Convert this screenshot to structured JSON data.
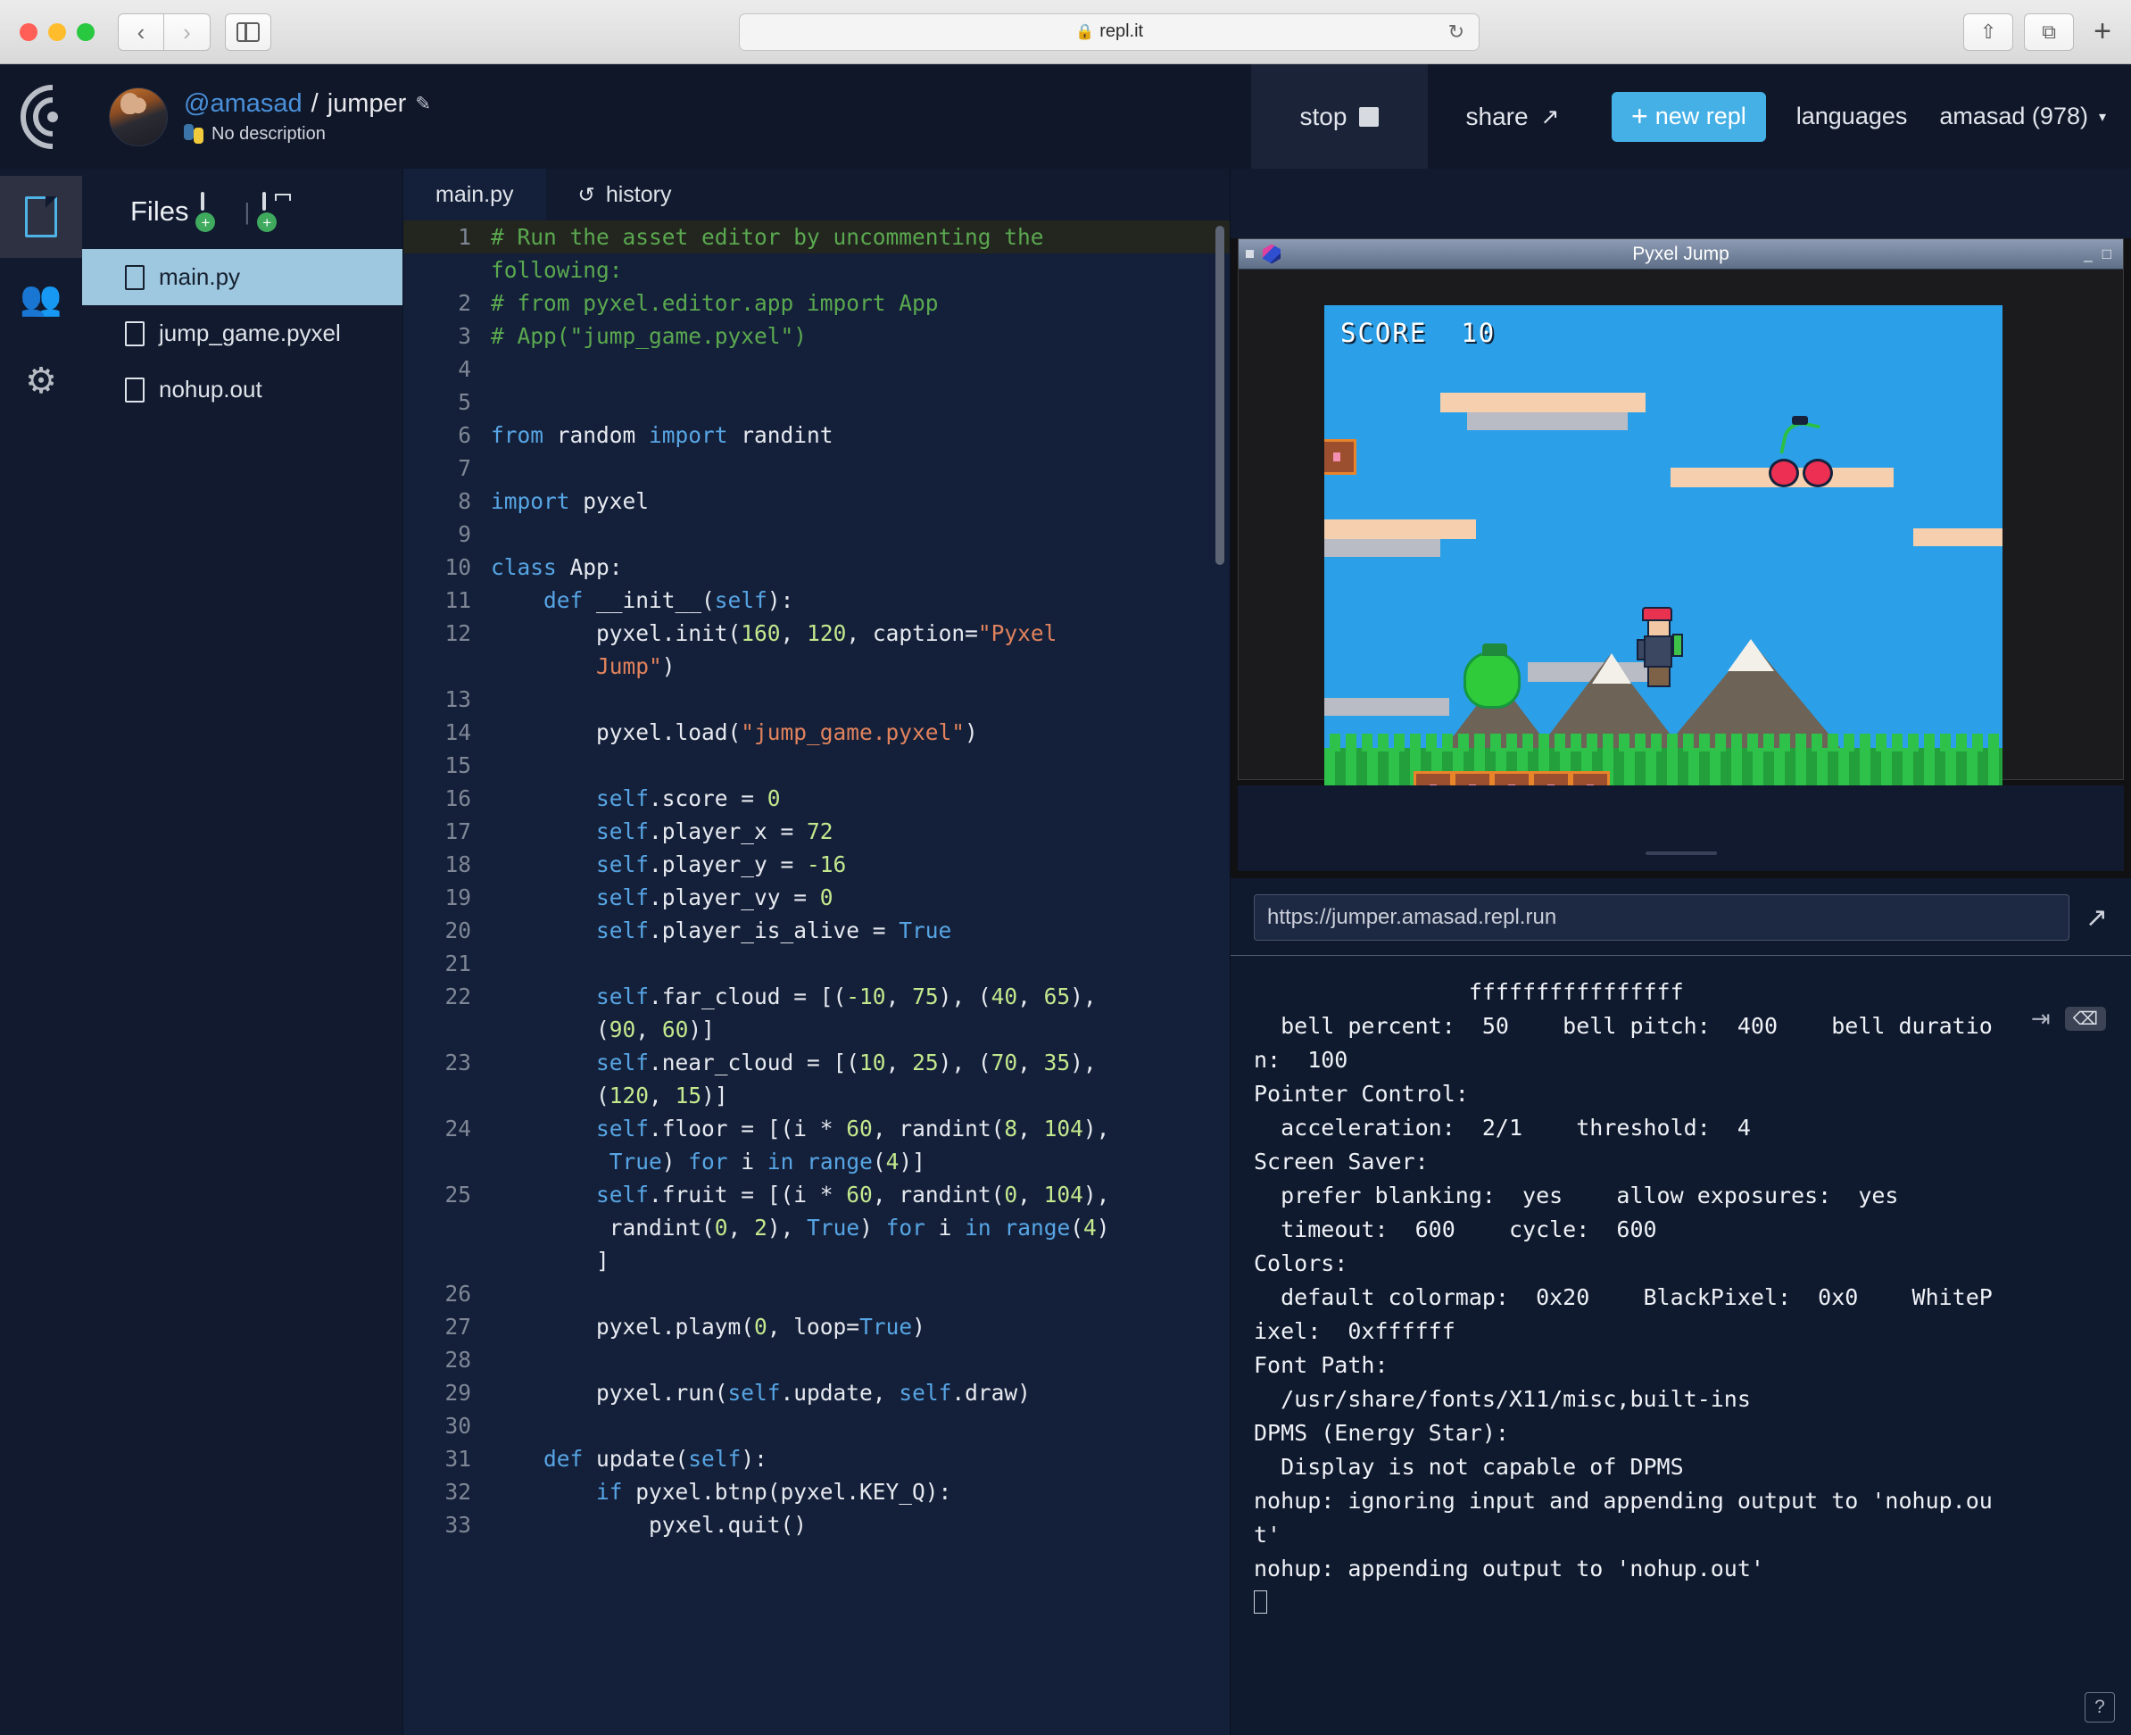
{
  "browser": {
    "url": "repl.it",
    "lock_icon": "lock-icon",
    "reload_icon": "reload-icon",
    "back_icon": "chevron-left-icon",
    "forward_icon": "chevron-right-icon",
    "sidebar_icon": "sidebar-toggle-icon",
    "share_icon": "share-icon",
    "tabs_icon": "tabs-overview-icon",
    "newtab_icon": "plus-icon"
  },
  "header": {
    "logo_icon": "replit-logo-icon",
    "avatar": "user-avatar",
    "username": "@amasad",
    "slash": "/",
    "replname": "jumper",
    "edit_icon": "pencil-icon",
    "language_icon": "python-icon",
    "description": "No description",
    "stop_label": "stop",
    "stop_icon": "stop-square-icon",
    "share_label": "share",
    "share_icon": "share-arrow-icon",
    "new_repl_label": "new repl",
    "new_repl_plus": "+",
    "languages_label": "languages",
    "account_label": "amasad (978)",
    "account_caret": "▾",
    "accent_color": "#45b0e6"
  },
  "rail": {
    "items": [
      {
        "name": "files",
        "icon": "document-icon",
        "active": true
      },
      {
        "name": "multiplayer",
        "icon": "add-people-icon",
        "active": false
      },
      {
        "name": "settings",
        "icon": "gear-icon",
        "active": false
      }
    ]
  },
  "files": {
    "title": "Files",
    "new_file_icon": "new-file-icon",
    "new_folder_icon": "new-folder-icon",
    "separator": "|",
    "items": [
      {
        "name": "main.py",
        "selected": true
      },
      {
        "name": "jump_game.pyxel",
        "selected": false
      },
      {
        "name": "nohup.out",
        "selected": false
      }
    ]
  },
  "editor": {
    "tabs": [
      {
        "label": "main.py",
        "icon": "",
        "active": true
      },
      {
        "label": "history",
        "icon": "history-icon",
        "active": false
      }
    ],
    "lines": [
      {
        "n": "1",
        "highlight": true,
        "tokens": [
          {
            "t": "# Run the asset editor by uncommenting the",
            "c": "cm"
          }
        ]
      },
      {
        "n": "",
        "highlight": false,
        "tokens": [
          {
            "t": "following:",
            "c": "cm"
          }
        ]
      },
      {
        "n": "2",
        "highlight": false,
        "tokens": [
          {
            "t": "# from pyxel.editor.app import App",
            "c": "cm"
          }
        ]
      },
      {
        "n": "3",
        "highlight": false,
        "tokens": [
          {
            "t": "# App(\"jump_game.pyxel\")",
            "c": "cm"
          }
        ]
      },
      {
        "n": "4",
        "highlight": false,
        "tokens": []
      },
      {
        "n": "5",
        "highlight": false,
        "tokens": []
      },
      {
        "n": "6",
        "highlight": false,
        "tokens": [
          {
            "t": "from",
            "c": "kw"
          },
          {
            "t": " random ",
            "c": "fn"
          },
          {
            "t": "import",
            "c": "kw"
          },
          {
            "t": " randint",
            "c": "fn"
          }
        ]
      },
      {
        "n": "7",
        "highlight": false,
        "tokens": []
      },
      {
        "n": "8",
        "highlight": false,
        "tokens": [
          {
            "t": "import",
            "c": "kw"
          },
          {
            "t": " pyxel",
            "c": "fn"
          }
        ]
      },
      {
        "n": "9",
        "highlight": false,
        "tokens": []
      },
      {
        "n": "10",
        "highlight": false,
        "tokens": [
          {
            "t": "class",
            "c": "kw"
          },
          {
            "t": " App:",
            "c": "fn"
          }
        ]
      },
      {
        "n": "11",
        "highlight": false,
        "tokens": [
          {
            "t": "    ",
            "c": "fn"
          },
          {
            "t": "def",
            "c": "kw"
          },
          {
            "t": " __init__(",
            "c": "fn"
          },
          {
            "t": "self",
            "c": "slf"
          },
          {
            "t": "):",
            "c": "fn"
          }
        ]
      },
      {
        "n": "12",
        "highlight": false,
        "tokens": [
          {
            "t": "        pyxel.init(",
            "c": "fn"
          },
          {
            "t": "160",
            "c": "nu"
          },
          {
            "t": ", ",
            "c": "fn"
          },
          {
            "t": "120",
            "c": "nu"
          },
          {
            "t": ", caption=",
            "c": "fn"
          },
          {
            "t": "\"Pyxel",
            "c": "st"
          }
        ]
      },
      {
        "n": "",
        "highlight": false,
        "tokens": [
          {
            "t": "        ",
            "c": "fn"
          },
          {
            "t": "Jump\"",
            "c": "st"
          },
          {
            "t": ")",
            "c": "fn"
          }
        ]
      },
      {
        "n": "13",
        "highlight": false,
        "tokens": []
      },
      {
        "n": "14",
        "highlight": false,
        "tokens": [
          {
            "t": "        pyxel.load(",
            "c": "fn"
          },
          {
            "t": "\"jump_game.pyxel\"",
            "c": "st"
          },
          {
            "t": ")",
            "c": "fn"
          }
        ]
      },
      {
        "n": "15",
        "highlight": false,
        "tokens": []
      },
      {
        "n": "16",
        "highlight": false,
        "tokens": [
          {
            "t": "        ",
            "c": "fn"
          },
          {
            "t": "self",
            "c": "slf"
          },
          {
            "t": ".score = ",
            "c": "fn"
          },
          {
            "t": "0",
            "c": "nu"
          }
        ]
      },
      {
        "n": "17",
        "highlight": false,
        "tokens": [
          {
            "t": "        ",
            "c": "fn"
          },
          {
            "t": "self",
            "c": "slf"
          },
          {
            "t": ".player_x = ",
            "c": "fn"
          },
          {
            "t": "72",
            "c": "nu"
          }
        ]
      },
      {
        "n": "18",
        "highlight": false,
        "tokens": [
          {
            "t": "        ",
            "c": "fn"
          },
          {
            "t": "self",
            "c": "slf"
          },
          {
            "t": ".player_y = ",
            "c": "fn"
          },
          {
            "t": "-16",
            "c": "nu"
          }
        ]
      },
      {
        "n": "19",
        "highlight": false,
        "tokens": [
          {
            "t": "        ",
            "c": "fn"
          },
          {
            "t": "self",
            "c": "slf"
          },
          {
            "t": ".player_vy = ",
            "c": "fn"
          },
          {
            "t": "0",
            "c": "nu"
          }
        ]
      },
      {
        "n": "20",
        "highlight": false,
        "tokens": [
          {
            "t": "        ",
            "c": "fn"
          },
          {
            "t": "self",
            "c": "slf"
          },
          {
            "t": ".player_is_alive = ",
            "c": "fn"
          },
          {
            "t": "True",
            "c": "kw"
          }
        ]
      },
      {
        "n": "21",
        "highlight": false,
        "tokens": []
      },
      {
        "n": "22",
        "highlight": false,
        "tokens": [
          {
            "t": "        ",
            "c": "fn"
          },
          {
            "t": "self",
            "c": "slf"
          },
          {
            "t": ".far_cloud = [(",
            "c": "fn"
          },
          {
            "t": "-10",
            "c": "nu"
          },
          {
            "t": ", ",
            "c": "fn"
          },
          {
            "t": "75",
            "c": "nu"
          },
          {
            "t": "), (",
            "c": "fn"
          },
          {
            "t": "40",
            "c": "nu"
          },
          {
            "t": ", ",
            "c": "fn"
          },
          {
            "t": "65",
            "c": "nu"
          },
          {
            "t": "),",
            "c": "fn"
          }
        ]
      },
      {
        "n": "",
        "highlight": false,
        "tokens": [
          {
            "t": "        (",
            "c": "fn"
          },
          {
            "t": "90",
            "c": "nu"
          },
          {
            "t": ", ",
            "c": "fn"
          },
          {
            "t": "60",
            "c": "nu"
          },
          {
            "t": ")]",
            "c": "fn"
          }
        ]
      },
      {
        "n": "23",
        "highlight": false,
        "tokens": [
          {
            "t": "        ",
            "c": "fn"
          },
          {
            "t": "self",
            "c": "slf"
          },
          {
            "t": ".near_cloud = [(",
            "c": "fn"
          },
          {
            "t": "10",
            "c": "nu"
          },
          {
            "t": ", ",
            "c": "fn"
          },
          {
            "t": "25",
            "c": "nu"
          },
          {
            "t": "), (",
            "c": "fn"
          },
          {
            "t": "70",
            "c": "nu"
          },
          {
            "t": ", ",
            "c": "fn"
          },
          {
            "t": "35",
            "c": "nu"
          },
          {
            "t": "),",
            "c": "fn"
          }
        ]
      },
      {
        "n": "",
        "highlight": false,
        "tokens": [
          {
            "t": "        (",
            "c": "fn"
          },
          {
            "t": "120",
            "c": "nu"
          },
          {
            "t": ", ",
            "c": "fn"
          },
          {
            "t": "15",
            "c": "nu"
          },
          {
            "t": ")]",
            "c": "fn"
          }
        ]
      },
      {
        "n": "24",
        "highlight": false,
        "tokens": [
          {
            "t": "        ",
            "c": "fn"
          },
          {
            "t": "self",
            "c": "slf"
          },
          {
            "t": ".floor = [(i * ",
            "c": "fn"
          },
          {
            "t": "60",
            "c": "nu"
          },
          {
            "t": ", randint(",
            "c": "fn"
          },
          {
            "t": "8",
            "c": "nu"
          },
          {
            "t": ", ",
            "c": "fn"
          },
          {
            "t": "104",
            "c": "nu"
          },
          {
            "t": "),",
            "c": "fn"
          }
        ]
      },
      {
        "n": "",
        "highlight": false,
        "tokens": [
          {
            "t": "         ",
            "c": "fn"
          },
          {
            "t": "True",
            "c": "kw"
          },
          {
            "t": ") ",
            "c": "fn"
          },
          {
            "t": "for",
            "c": "kw"
          },
          {
            "t": " i ",
            "c": "fn"
          },
          {
            "t": "in",
            "c": "kw"
          },
          {
            "t": " ",
            "c": "fn"
          },
          {
            "t": "range",
            "c": "kw"
          },
          {
            "t": "(",
            "c": "fn"
          },
          {
            "t": "4",
            "c": "nu"
          },
          {
            "t": ")]",
            "c": "fn"
          }
        ]
      },
      {
        "n": "25",
        "highlight": false,
        "tokens": [
          {
            "t": "        ",
            "c": "fn"
          },
          {
            "t": "self",
            "c": "slf"
          },
          {
            "t": ".fruit = [(i * ",
            "c": "fn"
          },
          {
            "t": "60",
            "c": "nu"
          },
          {
            "t": ", randint(",
            "c": "fn"
          },
          {
            "t": "0",
            "c": "nu"
          },
          {
            "t": ", ",
            "c": "fn"
          },
          {
            "t": "104",
            "c": "nu"
          },
          {
            "t": "),",
            "c": "fn"
          }
        ]
      },
      {
        "n": "",
        "highlight": false,
        "tokens": [
          {
            "t": "         randint(",
            "c": "fn"
          },
          {
            "t": "0",
            "c": "nu"
          },
          {
            "t": ", ",
            "c": "fn"
          },
          {
            "t": "2",
            "c": "nu"
          },
          {
            "t": "), ",
            "c": "fn"
          },
          {
            "t": "True",
            "c": "kw"
          },
          {
            "t": ") ",
            "c": "fn"
          },
          {
            "t": "for",
            "c": "kw"
          },
          {
            "t": " i ",
            "c": "fn"
          },
          {
            "t": "in",
            "c": "kw"
          },
          {
            "t": " ",
            "c": "fn"
          },
          {
            "t": "range",
            "c": "kw"
          },
          {
            "t": "(",
            "c": "fn"
          },
          {
            "t": "4",
            "c": "nu"
          },
          {
            "t": ")",
            "c": "fn"
          }
        ]
      },
      {
        "n": "",
        "highlight": false,
        "tokens": [
          {
            "t": "        ]",
            "c": "fn"
          }
        ]
      },
      {
        "n": "26",
        "highlight": false,
        "tokens": []
      },
      {
        "n": "27",
        "highlight": false,
        "tokens": [
          {
            "t": "        pyxel.playm(",
            "c": "fn"
          },
          {
            "t": "0",
            "c": "nu"
          },
          {
            "t": ", loop=",
            "c": "fn"
          },
          {
            "t": "True",
            "c": "kw"
          },
          {
            "t": ")",
            "c": "fn"
          }
        ]
      },
      {
        "n": "28",
        "highlight": false,
        "tokens": []
      },
      {
        "n": "29",
        "highlight": false,
        "tokens": [
          {
            "t": "        pyxel.run(",
            "c": "fn"
          },
          {
            "t": "self",
            "c": "slf"
          },
          {
            "t": ".update, ",
            "c": "fn"
          },
          {
            "t": "self",
            "c": "slf"
          },
          {
            "t": ".draw)",
            "c": "fn"
          }
        ]
      },
      {
        "n": "30",
        "highlight": false,
        "tokens": []
      },
      {
        "n": "31",
        "highlight": false,
        "tokens": [
          {
            "t": "    ",
            "c": "fn"
          },
          {
            "t": "def",
            "c": "kw"
          },
          {
            "t": " update(",
            "c": "fn"
          },
          {
            "t": "self",
            "c": "slf"
          },
          {
            "t": "):",
            "c": "fn"
          }
        ]
      },
      {
        "n": "32",
        "highlight": false,
        "tokens": [
          {
            "t": "        ",
            "c": "fn"
          },
          {
            "t": "if",
            "c": "kw"
          },
          {
            "t": " pyxel.btnp(pyxel.KEY_Q):",
            "c": "fn"
          }
        ]
      },
      {
        "n": "33",
        "highlight": false,
        "tokens": [
          {
            "t": "            pyxel.quit()",
            "c": "fn"
          }
        ]
      }
    ]
  },
  "preview": {
    "window_title": "Pyxel Jump",
    "app_icon": "pyxel-cube-icon",
    "minimize_icon": "_",
    "maximize_icon": "□",
    "game": {
      "score_label": "SCORE",
      "score_value": "10",
      "sky_color": "#2ba0e8",
      "cloud_color": "#f6cfae",
      "cloud_shadow_color": "#b9bcc4",
      "tree_color": "#2ec24a",
      "block_color": "#9c4f2e",
      "block_border_color": "#e8852a",
      "slime_color": "#2fcb3a",
      "cherry_color": "#ec2f52"
    }
  },
  "console": {
    "run_url": "https://jumper.amasad.repl.run",
    "open_external_icon": "open-external-icon",
    "input_icon": "enter-input-icon",
    "clear_icon": "clear-icon",
    "help_icon": "help-icon",
    "output": "                ffffffffffffffff\n  bell percent:  50    bell pitch:  400    bell duratio\nn:  100\nPointer Control:\n  acceleration:  2/1    threshold:  4\nScreen Saver:\n  prefer blanking:  yes    allow exposures:  yes\n  timeout:  600    cycle:  600\nColors:\n  default colormap:  0x20    BlackPixel:  0x0    WhiteP\nixel:  0xffffff\nFont Path:\n  /usr/share/fonts/X11/misc,built-ins\nDPMS (Energy Star):\n  Display is not capable of DPMS\nnohup: ignoring input and appending output to 'nohup.ou\nt'\nnohup: appending output to 'nohup.out'\n"
  }
}
